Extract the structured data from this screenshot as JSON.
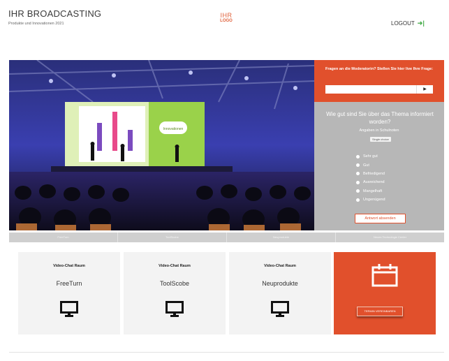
{
  "header": {
    "title": "IHR BROADCASTING",
    "subtitle": "Produkte und Innovationen 2021",
    "logo_line1": "IHR",
    "logo_line2": "LOGO",
    "logout_label": "LOGOUT",
    "logout_icon": "logout-icon"
  },
  "stage": {
    "slide_badge": "Innovationen"
  },
  "question": {
    "label": "Fragen an die Moderatorin? Stellen Sie hier live Ihre Frage:",
    "value": "",
    "send_glyph": "▶"
  },
  "poll": {
    "question": "Wie gut sind Sie über das Thema informiert worden?",
    "hint": "Angaben in Schulnoten",
    "badge": "Single choice",
    "options": [
      {
        "label": "Sehr gut"
      },
      {
        "label": "Gut"
      },
      {
        "label": "Befriedigend"
      },
      {
        "label": "Ausreichend"
      },
      {
        "label": "Mangelhaft"
      },
      {
        "label": "Ungenügend"
      }
    ],
    "submit_label": "Antwort absenden"
  },
  "tabs": [
    {
      "label": "FreeTurn"
    },
    {
      "label": "ToolScobe"
    },
    {
      "label": "Neuprodukte"
    },
    {
      "label": "Neues Technologie Center"
    }
  ],
  "cards": [
    {
      "heading": "Video-Chat Raum",
      "name": "FreeTurn"
    },
    {
      "heading": "Video-Chat Raum",
      "name": "ToolScobe"
    },
    {
      "heading": "Video-Chat Raum",
      "name": "Neuprodukte"
    }
  ],
  "termin": {
    "button_label": "TERMIN VEREINBAREN"
  },
  "colors": {
    "accent": "#e1502c",
    "panel_grey": "#b7b7b7",
    "card_bg": "#f3f3f3",
    "logout_icon": "#4caf50"
  }
}
